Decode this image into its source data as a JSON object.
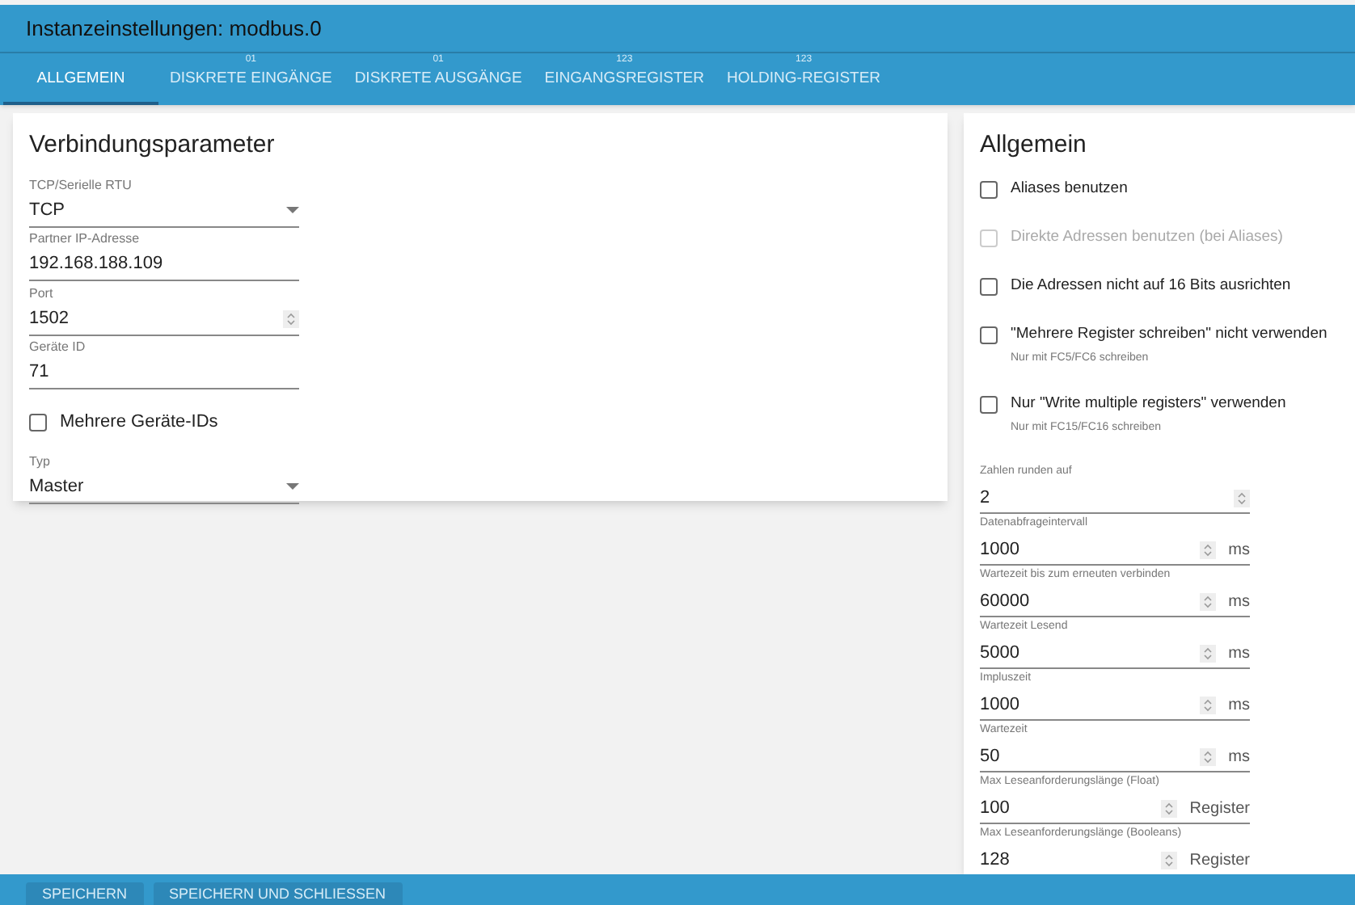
{
  "window": {
    "title": "Instanzeinstellungen: modbus.0"
  },
  "tabs": [
    {
      "label": "ALLGEMEIN",
      "selected": true
    },
    {
      "label": "DISKRETE EINGÄNGE",
      "badge": "01",
      "selected": false
    },
    {
      "label": "DISKRETE AUSGÄNGE",
      "badge": "01",
      "selected": false
    },
    {
      "label": "EINGANGSREGISTER",
      "badge": "123",
      "selected": false
    },
    {
      "label": "HOLDING-REGISTER",
      "badge": "123",
      "selected": false
    }
  ],
  "connection": {
    "title": "Verbindungsparameter",
    "fields": [
      {
        "kind": "select",
        "label": "TCP/Serielle RTU",
        "value": "TCP"
      },
      {
        "kind": "text",
        "label": "Partner IP-Adresse",
        "value": "192.168.188.109"
      },
      {
        "kind": "number",
        "label": "Port",
        "value": "1502"
      },
      {
        "kind": "text",
        "label": "Geräte ID",
        "value": "71"
      },
      {
        "kind": "checkbox",
        "label": "Mehrere Geräte-IDs",
        "checked": false
      },
      {
        "kind": "select",
        "label": "Typ",
        "value": "Master"
      }
    ]
  },
  "general": {
    "title": "Allgemein",
    "options": [
      {
        "label": "Aliases benutzen",
        "checked": false,
        "disabled": false
      },
      {
        "label": "Direkte Adressen benutzen (bei Aliases)",
        "checked": false,
        "disabled": true
      },
      {
        "label": "Die Adressen nicht auf 16 Bits ausrichten",
        "checked": false,
        "disabled": false
      },
      {
        "label": "\"Mehrere Register schreiben\" nicht verwenden",
        "hint": "Nur mit FC5/FC6 schreiben",
        "checked": false,
        "disabled": false
      },
      {
        "label": "Nur \"Write multiple registers\" verwenden",
        "hint": "Nur mit FC15/FC16 schreiben",
        "checked": false,
        "disabled": false
      }
    ],
    "fields": [
      {
        "label": "Zahlen runden auf",
        "value": "2"
      },
      {
        "label": "Datenabfrageintervall",
        "value": "1000",
        "unit": "ms"
      },
      {
        "label": "Wartezeit bis zum erneuten verbinden",
        "value": "60000",
        "unit": "ms"
      },
      {
        "label": "Wartezeit Lesend",
        "value": "5000",
        "unit": "ms"
      },
      {
        "label": "Impluszeit",
        "value": "1000",
        "unit": "ms"
      },
      {
        "label": "Wartezeit",
        "value": "50",
        "unit": "ms"
      },
      {
        "label": "Max Leseanforderungslänge (Float)",
        "value": "100",
        "unit": "Register"
      },
      {
        "label": "Max Leseanforderungslänge (Booleans)",
        "value": "128",
        "unit": "Register"
      }
    ]
  },
  "footer": {
    "buttons": [
      "SPEICHERN",
      "SPEICHERN UND SCHLIESSEN"
    ]
  }
}
